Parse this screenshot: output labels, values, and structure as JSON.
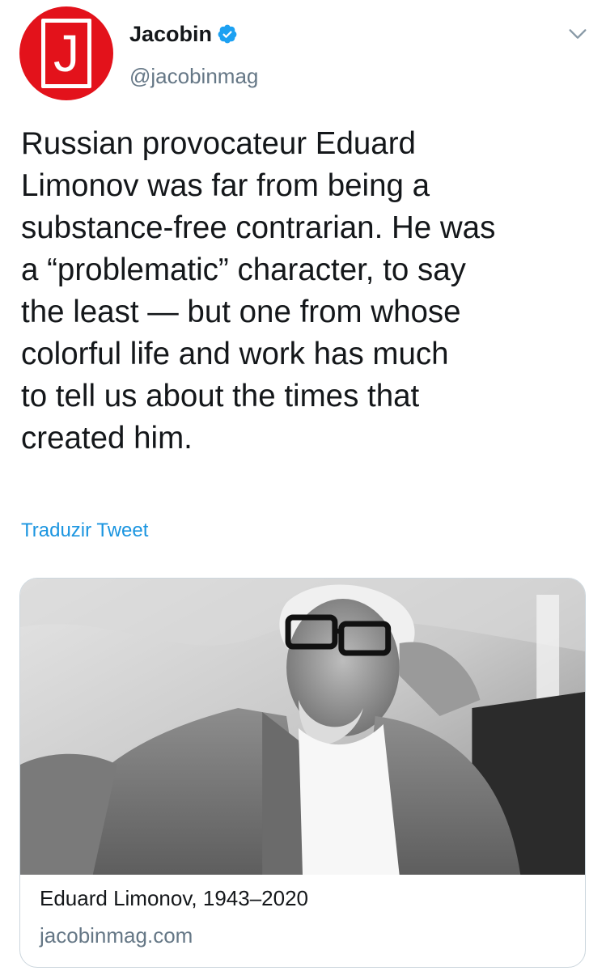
{
  "author": {
    "display_name": "Jacobin",
    "handle": "@jacobinmag",
    "avatar_letter": "J",
    "avatar_color": "#e3121b",
    "verified": true
  },
  "tweet": {
    "text": "Russian provocateur Eduard\nLimonov was far from being a\nsubstance-free contrarian. He was\na “problematic” character, to say\nthe least — but one from whose\ncolorful life and work has much\nto tell us about the times that\ncreated him.",
    "translate_label": "Traduzir Tweet"
  },
  "card": {
    "title": "Eduard Limonov, 1943–2020",
    "domain": "jacobinmag.com"
  },
  "colors": {
    "text": "#14171a",
    "secondary": "#657786",
    "link": "#1b95e0",
    "verified": "#1da1f2",
    "border": "#ccd6dd"
  }
}
